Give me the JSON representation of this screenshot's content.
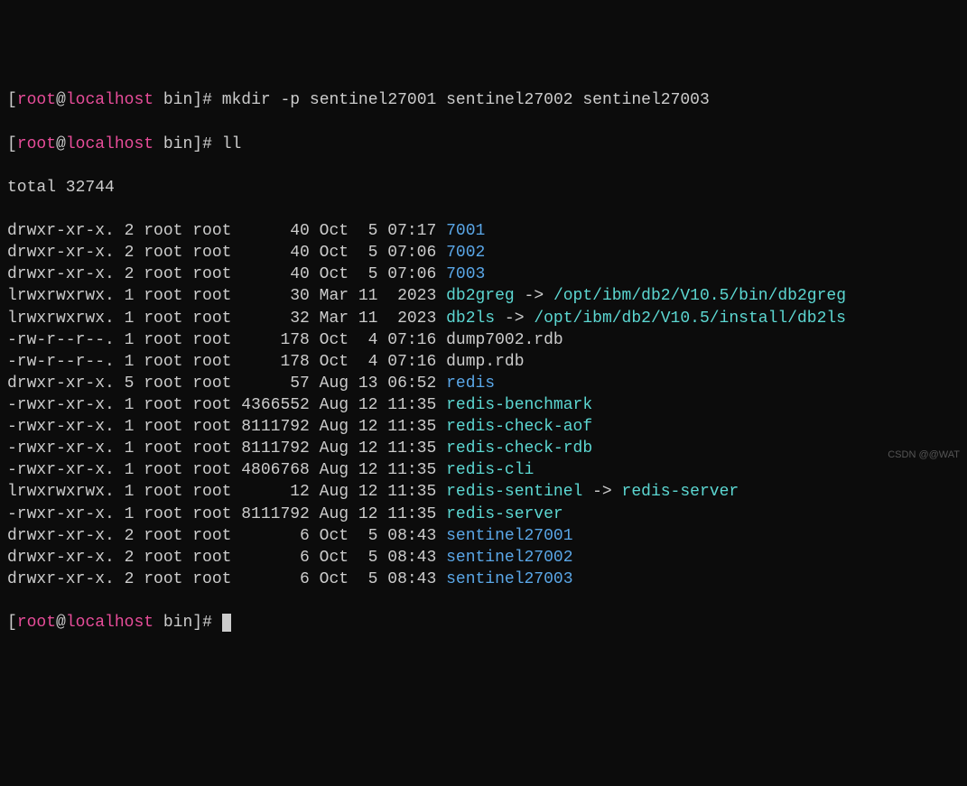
{
  "prompt": {
    "lbracket": "[",
    "user": "root",
    "at": "@",
    "host": "localhost",
    "path": " bin",
    "rbracket_hash": "]# "
  },
  "commands": {
    "mkdir": "mkdir -p sentinel27001 sentinel27002 sentinel27003",
    "ll": "ll"
  },
  "total_line": "total 32744",
  "listing": [
    {
      "perm": "drwxr-xr-x.",
      "links": "2",
      "owner": "root",
      "group": "root",
      "size": "40",
      "month": "Oct",
      "day": "5",
      "time": "07:17",
      "name": "7001",
      "cls": "dir"
    },
    {
      "perm": "drwxr-xr-x.",
      "links": "2",
      "owner": "root",
      "group": "root",
      "size": "40",
      "month": "Oct",
      "day": "5",
      "time": "07:06",
      "name": "7002",
      "cls": "dir"
    },
    {
      "perm": "drwxr-xr-x.",
      "links": "2",
      "owner": "root",
      "group": "root",
      "size": "40",
      "month": "Oct",
      "day": "5",
      "time": "07:06",
      "name": "7003",
      "cls": "dir"
    },
    {
      "perm": "lrwxrwxrwx.",
      "links": "1",
      "owner": "root",
      "group": "root",
      "size": "30",
      "month": "Mar",
      "day": "11",
      "time": "2023",
      "name": "db2greg",
      "cls": "lnk",
      "arrow": " -> ",
      "target": "/opt/ibm/db2/V10.5/bin/db2greg",
      "tcls": "exe"
    },
    {
      "perm": "lrwxrwxrwx.",
      "links": "1",
      "owner": "root",
      "group": "root",
      "size": "32",
      "month": "Mar",
      "day": "11",
      "time": "2023",
      "name": "db2ls",
      "cls": "lnk",
      "arrow": " -> ",
      "target": "/opt/ibm/db2/V10.5/install/db2ls",
      "tcls": "exe"
    },
    {
      "perm": "-rw-r--r--.",
      "links": "1",
      "owner": "root",
      "group": "root",
      "size": "178",
      "month": "Oct",
      "day": "4",
      "time": "07:16",
      "name": "dump7002.rdb",
      "cls": "plain"
    },
    {
      "perm": "-rw-r--r--.",
      "links": "1",
      "owner": "root",
      "group": "root",
      "size": "178",
      "month": "Oct",
      "day": "4",
      "time": "07:16",
      "name": "dump.rdb",
      "cls": "plain"
    },
    {
      "perm": "drwxr-xr-x.",
      "links": "5",
      "owner": "root",
      "group": "root",
      "size": "57",
      "month": "Aug",
      "day": "13",
      "time": "06:52",
      "name": "redis",
      "cls": "dir"
    },
    {
      "perm": "-rwxr-xr-x.",
      "links": "1",
      "owner": "root",
      "group": "root",
      "size": "4366552",
      "month": "Aug",
      "day": "12",
      "time": "11:35",
      "name": "redis-benchmark",
      "cls": "exe"
    },
    {
      "perm": "-rwxr-xr-x.",
      "links": "1",
      "owner": "root",
      "group": "root",
      "size": "8111792",
      "month": "Aug",
      "day": "12",
      "time": "11:35",
      "name": "redis-check-aof",
      "cls": "exe"
    },
    {
      "perm": "-rwxr-xr-x.",
      "links": "1",
      "owner": "root",
      "group": "root",
      "size": "8111792",
      "month": "Aug",
      "day": "12",
      "time": "11:35",
      "name": "redis-check-rdb",
      "cls": "exe"
    },
    {
      "perm": "-rwxr-xr-x.",
      "links": "1",
      "owner": "root",
      "group": "root",
      "size": "4806768",
      "month": "Aug",
      "day": "12",
      "time": "11:35",
      "name": "redis-cli",
      "cls": "exe"
    },
    {
      "perm": "lrwxrwxrwx.",
      "links": "1",
      "owner": "root",
      "group": "root",
      "size": "12",
      "month": "Aug",
      "day": "12",
      "time": "11:35",
      "name": "redis-sentinel",
      "cls": "lnk",
      "arrow": " -> ",
      "target": "redis-server",
      "tcls": "exe"
    },
    {
      "perm": "-rwxr-xr-x.",
      "links": "1",
      "owner": "root",
      "group": "root",
      "size": "8111792",
      "month": "Aug",
      "day": "12",
      "time": "11:35",
      "name": "redis-server",
      "cls": "exe"
    },
    {
      "perm": "drwxr-xr-x.",
      "links": "2",
      "owner": "root",
      "group": "root",
      "size": "6",
      "month": "Oct",
      "day": "5",
      "time": "08:43",
      "name": "sentinel27001",
      "cls": "dir"
    },
    {
      "perm": "drwxr-xr-x.",
      "links": "2",
      "owner": "root",
      "group": "root",
      "size": "6",
      "month": "Oct",
      "day": "5",
      "time": "08:43",
      "name": "sentinel27002",
      "cls": "dir"
    },
    {
      "perm": "drwxr-xr-x.",
      "links": "2",
      "owner": "root",
      "group": "root",
      "size": "6",
      "month": "Oct",
      "day": "5",
      "time": "08:43",
      "name": "sentinel27003",
      "cls": "dir"
    }
  ],
  "watermark": "CSDN @@WAT"
}
